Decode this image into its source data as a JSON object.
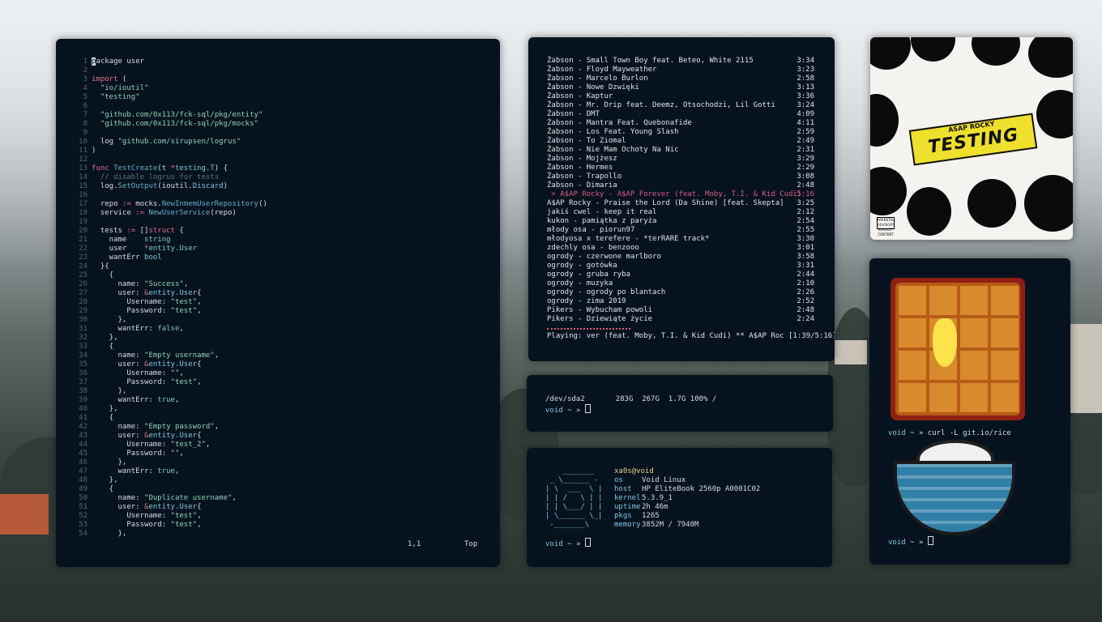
{
  "editor": {
    "lines": [
      [
        [
          "cursor",
          "p"
        ],
        [
          "pl",
          "ackage user"
        ]
      ],
      [],
      [
        [
          "kw",
          "import"
        ],
        [
          "pl",
          " ("
        ]
      ],
      [
        [
          "pl",
          "  "
        ],
        [
          "str",
          "\"io/ioutil\""
        ]
      ],
      [
        [
          "pl",
          "  "
        ],
        [
          "str",
          "\"testing\""
        ]
      ],
      [],
      [
        [
          "pl",
          "  "
        ],
        [
          "str",
          "\"github.com/0x113/fck-sql/pkg/entity\""
        ]
      ],
      [
        [
          "pl",
          "  "
        ],
        [
          "str",
          "\"github.com/0x113/fck-sql/pkg/mocks\""
        ]
      ],
      [],
      [
        [
          "pl",
          "  log "
        ],
        [
          "str",
          "\"github.com/sirupsen/logrus\""
        ]
      ],
      [
        [
          "pl",
          ")"
        ]
      ],
      [],
      [
        [
          "kw",
          "func "
        ],
        [
          "fn",
          "TestCreate"
        ],
        [
          "pl",
          "(t "
        ],
        [
          "kw",
          "*"
        ],
        [
          "typ",
          "testing.T"
        ],
        [
          "pl",
          ") {"
        ]
      ],
      [
        [
          "pl",
          "  "
        ],
        [
          "cm",
          "// disable logrus for tests"
        ]
      ],
      [
        [
          "pl",
          "  log."
        ],
        [
          "fn",
          "SetOutput"
        ],
        [
          "pl",
          "(ioutil."
        ],
        [
          "typ",
          "Discard"
        ],
        [
          "pl",
          ")"
        ]
      ],
      [],
      [
        [
          "pl",
          "  repo "
        ],
        [
          "kw",
          ":="
        ],
        [
          "pl",
          " mocks."
        ],
        [
          "fn",
          "NewInmemUserRepository"
        ],
        [
          "pl",
          "()"
        ]
      ],
      [
        [
          "pl",
          "  service "
        ],
        [
          "kw",
          ":="
        ],
        [
          "pl",
          " "
        ],
        [
          "fn",
          "NewUserService"
        ],
        [
          "pl",
          "(repo)"
        ]
      ],
      [],
      [
        [
          "pl",
          "  tests "
        ],
        [
          "kw",
          ":="
        ],
        [
          "pl",
          " []"
        ],
        [
          "kw",
          "struct"
        ],
        [
          "pl",
          " {"
        ]
      ],
      [
        [
          "pl",
          "    name    "
        ],
        [
          "typ",
          "string"
        ]
      ],
      [
        [
          "pl",
          "    user    "
        ],
        [
          "kw",
          "*"
        ],
        [
          "typ",
          "entity.User"
        ]
      ],
      [
        [
          "pl",
          "    wantErr "
        ],
        [
          "typ",
          "bool"
        ]
      ],
      [
        [
          "pl",
          "  }{"
        ]
      ],
      [
        [
          "pl",
          "    {"
        ]
      ],
      [
        [
          "pl",
          "      name: "
        ],
        [
          "str",
          "\"Success\""
        ],
        [
          "pl",
          ","
        ]
      ],
      [
        [
          "pl",
          "      user: "
        ],
        [
          "kw",
          "&"
        ],
        [
          "typ",
          "entity.User"
        ],
        [
          "pl",
          "{"
        ]
      ],
      [
        [
          "pl",
          "        Username: "
        ],
        [
          "str",
          "\"test\""
        ],
        [
          "pl",
          ","
        ]
      ],
      [
        [
          "pl",
          "        Password: "
        ],
        [
          "str",
          "\"test\""
        ],
        [
          "pl",
          ","
        ]
      ],
      [
        [
          "pl",
          "      },"
        ]
      ],
      [
        [
          "pl",
          "      wantErr: "
        ],
        [
          "typ",
          "false"
        ],
        [
          "pl",
          ","
        ]
      ],
      [
        [
          "pl",
          "    },"
        ]
      ],
      [
        [
          "pl",
          "    {"
        ]
      ],
      [
        [
          "pl",
          "      name: "
        ],
        [
          "str",
          "\"Empty username\""
        ],
        [
          "pl",
          ","
        ]
      ],
      [
        [
          "pl",
          "      user: "
        ],
        [
          "kw",
          "&"
        ],
        [
          "typ",
          "entity.User"
        ],
        [
          "pl",
          "{"
        ]
      ],
      [
        [
          "pl",
          "        Username: "
        ],
        [
          "str",
          "\"\""
        ],
        [
          "pl",
          ","
        ]
      ],
      [
        [
          "pl",
          "        Password: "
        ],
        [
          "str",
          "\"test\""
        ],
        [
          "pl",
          ","
        ]
      ],
      [
        [
          "pl",
          "      },"
        ]
      ],
      [
        [
          "pl",
          "      wantErr: "
        ],
        [
          "typ",
          "true"
        ],
        [
          "pl",
          ","
        ]
      ],
      [
        [
          "pl",
          "    },"
        ]
      ],
      [
        [
          "pl",
          "    {"
        ]
      ],
      [
        [
          "pl",
          "      name: "
        ],
        [
          "str",
          "\"Empty password\""
        ],
        [
          "pl",
          ","
        ]
      ],
      [
        [
          "pl",
          "      user: "
        ],
        [
          "kw",
          "&"
        ],
        [
          "typ",
          "entity.User"
        ],
        [
          "pl",
          "{"
        ]
      ],
      [
        [
          "pl",
          "        Username: "
        ],
        [
          "str",
          "\"test_2\""
        ],
        [
          "pl",
          ","
        ]
      ],
      [
        [
          "pl",
          "        Password: "
        ],
        [
          "str",
          "\"\""
        ],
        [
          "pl",
          ","
        ]
      ],
      [
        [
          "pl",
          "      },"
        ]
      ],
      [
        [
          "pl",
          "      wantErr: "
        ],
        [
          "typ",
          "true"
        ],
        [
          "pl",
          ","
        ]
      ],
      [
        [
          "pl",
          "    },"
        ]
      ],
      [
        [
          "pl",
          "    {"
        ]
      ],
      [
        [
          "pl",
          "      name: "
        ],
        [
          "str",
          "\"Duplicate username\""
        ],
        [
          "pl",
          ","
        ]
      ],
      [
        [
          "pl",
          "      user: "
        ],
        [
          "kw",
          "&"
        ],
        [
          "typ",
          "entity.User"
        ],
        [
          "pl",
          "{"
        ]
      ],
      [
        [
          "pl",
          "        Username: "
        ],
        [
          "str",
          "\"test\""
        ],
        [
          "pl",
          ","
        ]
      ],
      [
        [
          "pl",
          "        Password: "
        ],
        [
          "str",
          "\"test\""
        ],
        [
          "pl",
          ","
        ]
      ],
      [
        [
          "pl",
          "      },"
        ]
      ]
    ],
    "status_position": "1,1",
    "status_scroll": "Top"
  },
  "music": {
    "tracks": [
      {
        "title": "Żabson - Small Town Boy feat. Beteo, White 2115",
        "duration": "3:34"
      },
      {
        "title": "Żabson - Floyd Mayweather",
        "duration": "3:23"
      },
      {
        "title": "Żabson - Marcelo Burlon",
        "duration": "2:58"
      },
      {
        "title": "Żabson - Nowe Dzwięki",
        "duration": "3:13"
      },
      {
        "title": "Żabson - Kaptur",
        "duration": "3:36"
      },
      {
        "title": "Żabson - Mr. Drip feat. Deemz, Otsochodzi, Lil Gotti",
        "duration": "3:24"
      },
      {
        "title": "Żabson - DMT",
        "duration": "4:09"
      },
      {
        "title": "Żabson - Mantra Feat. Quebonafide",
        "duration": "4:11"
      },
      {
        "title": "Żabson - Los Feat. Young Slash",
        "duration": "2:59"
      },
      {
        "title": "Żabson - To Ziomal",
        "duration": "2:49"
      },
      {
        "title": "Żabson - Nie Mam Ochoty Na Nic",
        "duration": "2:31"
      },
      {
        "title": "Żabson - Mojżesz",
        "duration": "3:29"
      },
      {
        "title": "Żabson - Hermes",
        "duration": "2:29"
      },
      {
        "title": "Żabson - Trapollo",
        "duration": "3:08"
      },
      {
        "title": "Żabson - Dimaria",
        "duration": "2:48"
      },
      {
        "title": " > A$AP Rocky - A$AP Forever (feat. Moby, T.I. & Kid Cudi)",
        "duration": "5:16",
        "now": true
      },
      {
        "title": "A$AP Rocky - Praise the Lord (Da Shine) [feat. Skepta]",
        "duration": "3:25"
      },
      {
        "title": "jakiś cwel - keep it real",
        "duration": "2:12"
      },
      {
        "title": "kukon - pamiątka z paryża",
        "duration": "2:54"
      },
      {
        "title": "młody osa - piorun97",
        "duration": "2:55"
      },
      {
        "title": "młodyosa x terefere - *terRARE track*",
        "duration": "3:30"
      },
      {
        "title": "zdechly osa - benzooo",
        "duration": "3:01"
      },
      {
        "title": "ogrody - czerwone marlboro",
        "duration": "3:58"
      },
      {
        "title": "ogrody - gotówka",
        "duration": "3:31"
      },
      {
        "title": "ogrody - gruba ryba",
        "duration": "2:44"
      },
      {
        "title": "ogrody - muzyka",
        "duration": "2:10"
      },
      {
        "title": "ogrody - ogrody po blantach",
        "duration": "2:26"
      },
      {
        "title": "ogrody - zima 2019",
        "duration": "2:52"
      },
      {
        "title": "Pikers - Wybucham powoli",
        "duration": "2:48"
      },
      {
        "title": "Pikers - Dziewiąte życie",
        "duration": "2:24"
      }
    ],
    "progress": 0.31,
    "playing": "Playing: ver (feat. Moby, T.I. & Kid Cudi) ** A$AP Roc [1:39/5:16]"
  },
  "df": {
    "line": "/dev/sda2       283G  267G  1.7G 100% /",
    "prompt_user": "void",
    "prompt_sep": " ~ » "
  },
  "neofetch": {
    "ascii": "    _______\n _ \\______ -\n| \\  ___  \\ |\n| | /   \\ | |\n| | \\___/ | |\n| \\______ \\_|\n -_______\\",
    "userhost": "xa0s@void",
    "fields": [
      {
        "key": "os",
        "value": "Void Linux"
      },
      {
        "key": "host",
        "value": "HP EliteBook 2560p A0001C02"
      },
      {
        "key": "kernel",
        "value": "5.3.9_1"
      },
      {
        "key": "uptime",
        "value": "2h 46m"
      },
      {
        "key": "pkgs",
        "value": "1265"
      },
      {
        "key": "memory",
        "value": "3852M / 7940M"
      }
    ],
    "prompt_user": "void",
    "prompt_sep": " ~ » "
  },
  "album": {
    "artist": "ASAP ROCKY",
    "title": "TESTING",
    "advisory": "PARENTAL ADVISORY EXPLICIT CONTENT"
  },
  "pix": {
    "prompt_user": "void",
    "prompt_sep": " ~ » ",
    "command": "curl -L git.io/rice",
    "prompt2_user": "void",
    "prompt2_sep": " ~ » "
  },
  "colors": {
    "terminal_bg": "#06131f",
    "accent_pink": "#d85a82",
    "accent_cyan": "#7ec6e2",
    "string_green": "#8fd3b5",
    "keyword_red": "#e56d8b"
  }
}
